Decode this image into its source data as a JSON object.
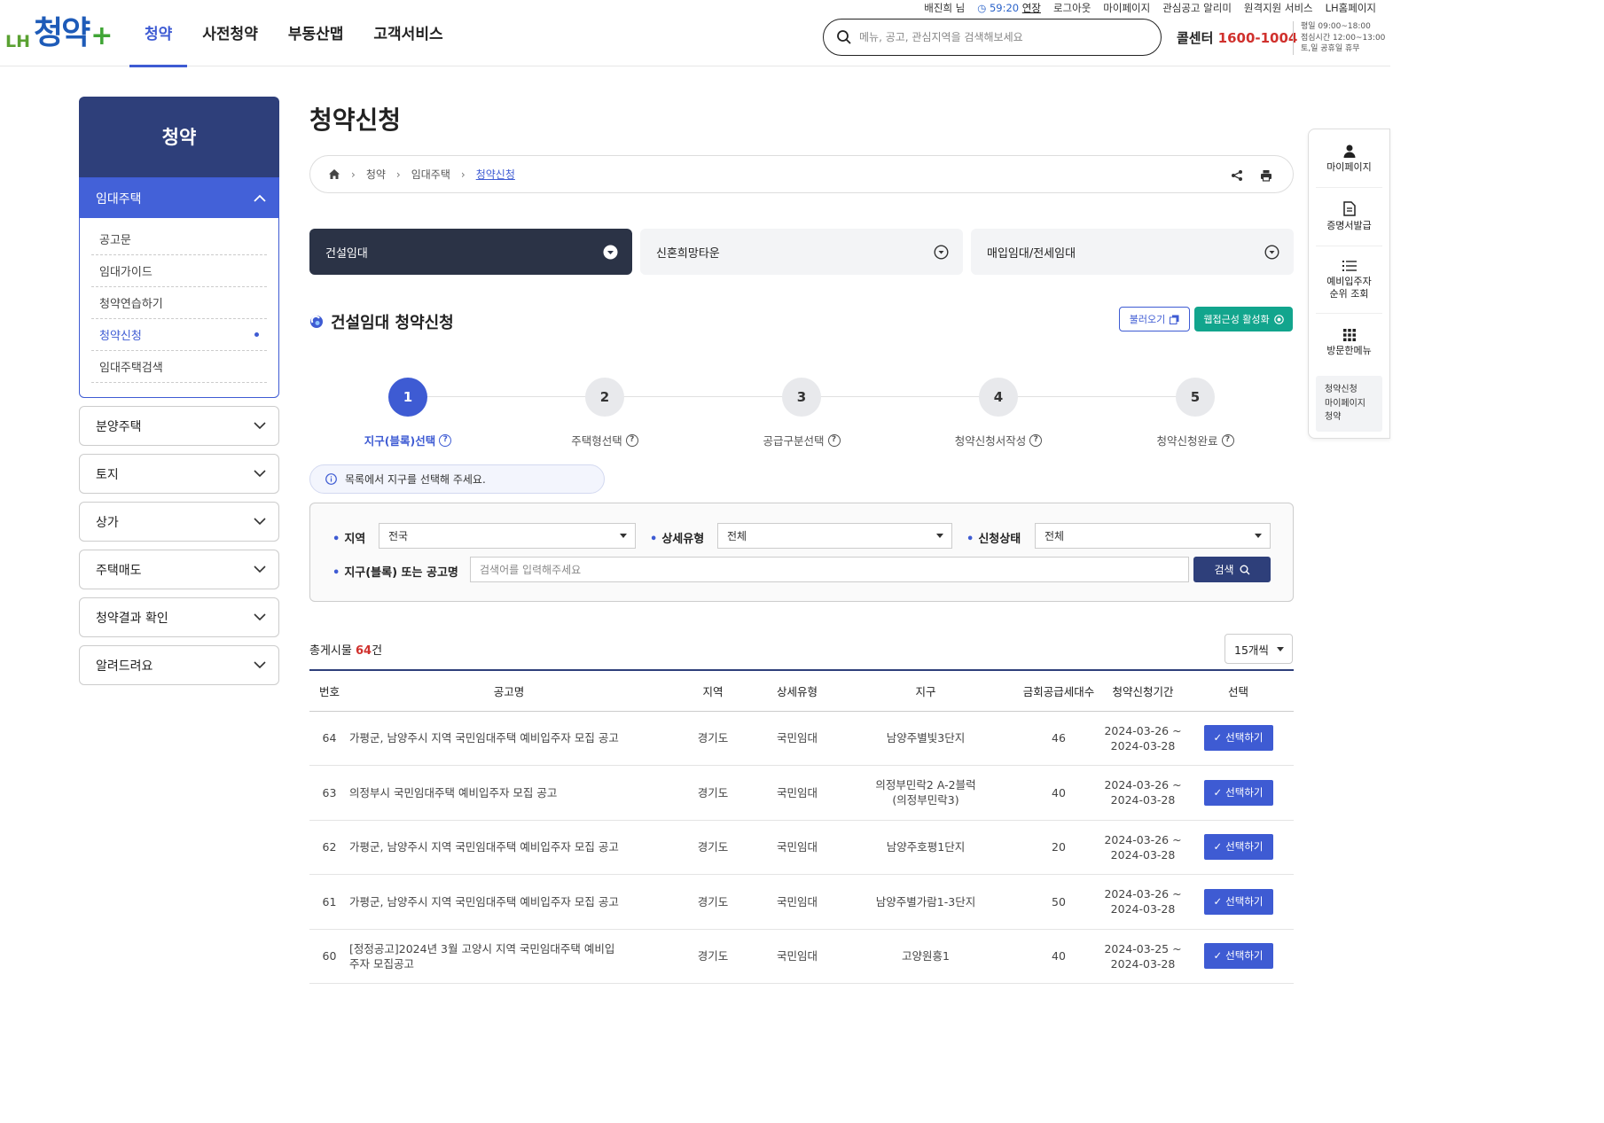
{
  "header": {
    "logo": {
      "brand": "LH",
      "name": "청약",
      "plus": "+"
    },
    "nav": [
      "청약",
      "사전청약",
      "부동산맵",
      "고객서비스"
    ],
    "util": {
      "user": "배진희 님",
      "timer": "59:20",
      "extend": "연장",
      "logout": "로그아웃",
      "mypage": "마이페이지",
      "alert": "관심공고 알리미",
      "remote": "원격지원 서비스",
      "home": "LH홈페이지"
    },
    "search_placeholder": "메뉴, 공고, 관심지역을 검색해보세요",
    "callcenter": {
      "label": "콜센터",
      "number": "1600-1004"
    },
    "hours": [
      "평일 09:00~18:00",
      "점심시간 12:00~13:00",
      "토,일 공휴일 휴무"
    ]
  },
  "sidebar": {
    "title": "청약",
    "open_group": "임대주택",
    "open_items": [
      "공고문",
      "임대가이드",
      "청약연습하기",
      "청약신청",
      "임대주택검색"
    ],
    "groups": [
      "분양주택",
      "토지",
      "상가",
      "주택매도",
      "청약결과 확인",
      "알려드려요"
    ]
  },
  "main": {
    "page_title": "청약신청",
    "breadcrumb": [
      "청약",
      "임대주택",
      "청약신청"
    ],
    "tabs": [
      "건설임대",
      "신혼희망타운",
      "매입임대/전세임대"
    ],
    "section_title": "건설임대 청약신청",
    "btn_load": "불러오기",
    "btn_web": "웹접근성 활성화",
    "steps": [
      "지구(블록)선택",
      "주택형선택",
      "공급구분선택",
      "청약신청서작성",
      "청약신청완료"
    ],
    "notice": "목록에서 지구를 선택해 주세요.",
    "filter": {
      "region_label": "지역",
      "region_value": "전국",
      "type_label": "상세유형",
      "type_value": "전체",
      "status_label": "신청상태",
      "status_value": "전체",
      "keyword_label": "지구(블록) 또는 공고명",
      "keyword_placeholder": "검색어를 입력해주세요",
      "search_btn": "검색"
    },
    "total_prefix": "총게시물",
    "total_count": "64",
    "total_suffix": "건",
    "per_page": "15개씩",
    "table": {
      "headers": [
        "번호",
        "공고명",
        "지역",
        "상세유형",
        "지구",
        "금회공급세대수",
        "청약신청기간",
        "선택"
      ],
      "select_label": "선택하기",
      "rows": [
        {
          "no": "64",
          "title": "가평군, 남양주시 지역 국민임대주택 예비입주자 모집 공고",
          "region": "경기도",
          "type": "국민임대",
          "district": "남양주별빛3단지",
          "units": "46",
          "start": "2024-03-26 ~",
          "end": "2024-03-28"
        },
        {
          "no": "63",
          "title": "의정부시 국민임대주택 예비입주자 모집 공고",
          "region": "경기도",
          "type": "국민임대",
          "district": "의정부민락2 A-2블럭 (의정부민락3)",
          "units": "40",
          "start": "2024-03-26 ~",
          "end": "2024-03-28"
        },
        {
          "no": "62",
          "title": "가평군, 남양주시 지역 국민임대주택 예비입주자 모집 공고",
          "region": "경기도",
          "type": "국민임대",
          "district": "남양주호평1단지",
          "units": "20",
          "start": "2024-03-26 ~",
          "end": "2024-03-28"
        },
        {
          "no": "61",
          "title": "가평군, 남양주시 지역 국민임대주택 예비입주자 모집 공고",
          "region": "경기도",
          "type": "국민임대",
          "district": "남양주별가람1-3단지",
          "units": "50",
          "start": "2024-03-26 ~",
          "end": "2024-03-28"
        },
        {
          "no": "60",
          "title": "[정정공고]2024년 3월 고양시 지역 국민임대주택 예비입주자 모집공고",
          "region": "경기도",
          "type": "국민임대",
          "district": "고양원흥1",
          "units": "40",
          "start": "2024-03-25 ~",
          "end": "2024-03-28"
        }
      ]
    }
  },
  "quick": {
    "items": [
      "마이페이지",
      "증명서발급",
      "예비입주자 순위 조회",
      "방문한메뉴"
    ],
    "recent": [
      "청약신청",
      "마이페이지",
      "청약"
    ]
  }
}
